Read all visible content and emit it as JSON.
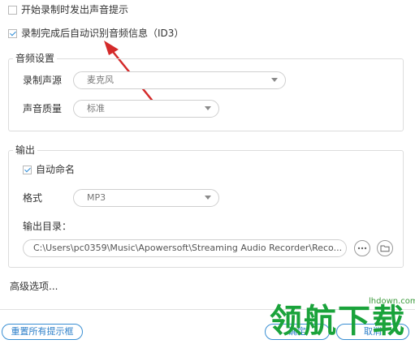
{
  "options": {
    "sound_prompt_label": "开始录制时发出声音提示",
    "sound_prompt_checked": false,
    "id3_label": "录制完成后自动识别音频信息（ID3）",
    "id3_checked": true
  },
  "audio_settings": {
    "group_title": "音频设置",
    "source_label": "录制声源",
    "source_value": "麦克风",
    "quality_label": "声音质量",
    "quality_value": "标准"
  },
  "output": {
    "group_title": "输出",
    "auto_name_label": "自动命名",
    "auto_name_checked": true,
    "format_label": "格式",
    "format_value": "MP3",
    "dir_label": "输出目录：",
    "dir_value": "C:\\Users\\pc0359\\Music\\Apowersoft\\Streaming Audio Recorder\\Reco..."
  },
  "advanced_label": "高级选项...",
  "footer": {
    "reset_label": "重置所有提示框",
    "ok_label": "确定",
    "cancel_label": "取消"
  },
  "watermark": {
    "text": "领航下载",
    "url": "lhdown.com"
  },
  "icons": {
    "more": "more-horizontal-icon",
    "folder": "folder-icon",
    "arrow": "red-arrow-annotation"
  },
  "colors": {
    "accent": "#2c8bd6",
    "arrow": "#d42a2a",
    "watermark": "#1aa33b"
  }
}
